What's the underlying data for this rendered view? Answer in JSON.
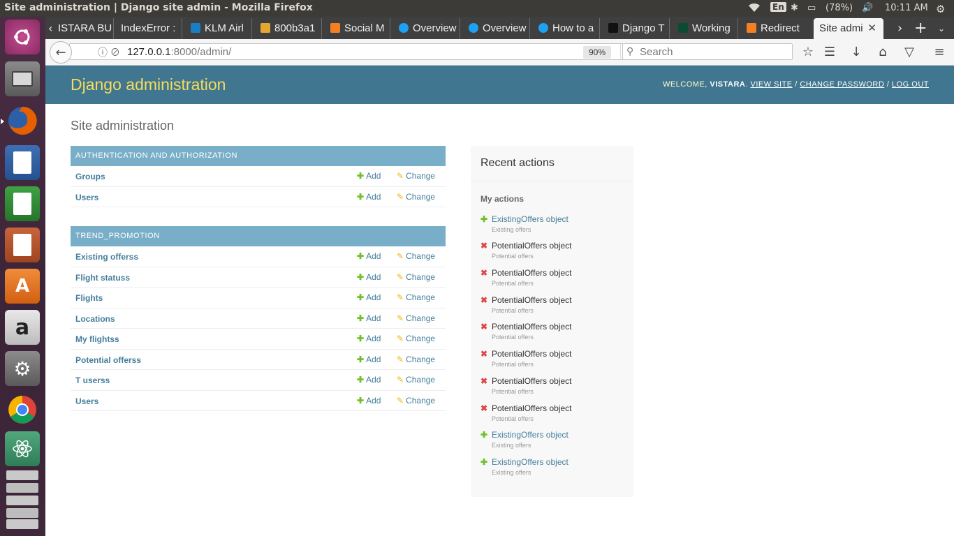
{
  "os": {
    "window_title": "Site administration | Django site admin - Mozilla Firefox",
    "keyboard": "En",
    "battery": "(78%)",
    "clock": "10:11 AM"
  },
  "launcher": [
    "ubuntu-dash",
    "files",
    "firefox",
    "writer",
    "calc",
    "impress",
    "software-center",
    "amazon",
    "system-settings",
    "chrome",
    "atom",
    "workspaces"
  ],
  "tabs": [
    {
      "label": "ISTARA BU"
    },
    {
      "label": "IndexError :"
    },
    {
      "label": "KLM Airl"
    },
    {
      "label": "800b3a1"
    },
    {
      "label": "Social M"
    },
    {
      "label": "Overview"
    },
    {
      "label": "Overview"
    },
    {
      "label": "How to a"
    },
    {
      "label": "Django T"
    },
    {
      "label": "Working"
    },
    {
      "label": "Redirect"
    },
    {
      "label": "Site admi"
    }
  ],
  "nav": {
    "url_host": "127.0.0.1",
    "url_rest": ":8000/admin/",
    "zoom": "90%",
    "search_placeholder": "Search"
  },
  "admin": {
    "brand": "Django administration",
    "welcome": "WELCOME,",
    "username": "VISTARA",
    "view_site": "VIEW SITE",
    "change_password": "CHANGE PASSWORD",
    "logout": "LOG OUT",
    "page_title": "Site administration",
    "add_label": "Add",
    "change_label": "Change",
    "modules": [
      {
        "caption": "AUTHENTICATION AND AUTHORIZATION",
        "models": [
          "Groups",
          "Users"
        ]
      },
      {
        "caption": "TREND_PROMOTION",
        "models": [
          "Existing offerss",
          "Flight statuss",
          "Flights",
          "Locations",
          "My flightss",
          "Potential offerss",
          "T userss",
          "Users"
        ]
      }
    ]
  },
  "recent": {
    "title": "Recent actions",
    "subtitle": "My actions",
    "items": [
      {
        "action": "add",
        "name": "ExistingOffers object",
        "type": "Existing offers"
      },
      {
        "action": "delete",
        "name": "PotentialOffers object",
        "type": "Potential offers"
      },
      {
        "action": "delete",
        "name": "PotentialOffers object",
        "type": "Potential offers"
      },
      {
        "action": "delete",
        "name": "PotentialOffers object",
        "type": "Potential offers"
      },
      {
        "action": "delete",
        "name": "PotentialOffers object",
        "type": "Potential offers"
      },
      {
        "action": "delete",
        "name": "PotentialOffers object",
        "type": "Potential offers"
      },
      {
        "action": "delete",
        "name": "PotentialOffers object",
        "type": "Potential offers"
      },
      {
        "action": "delete",
        "name": "PotentialOffers object",
        "type": "Potential offers"
      },
      {
        "action": "add",
        "name": "ExistingOffers object",
        "type": "Existing offers"
      },
      {
        "action": "add",
        "name": "ExistingOffers object",
        "type": "Existing offers"
      }
    ]
  },
  "colors": {
    "header": "#417690",
    "brand": "#f5dd5d",
    "caption": "#79aec8",
    "link": "#447e9b",
    "add": "#70bf2b",
    "delete": "#dd4646"
  }
}
